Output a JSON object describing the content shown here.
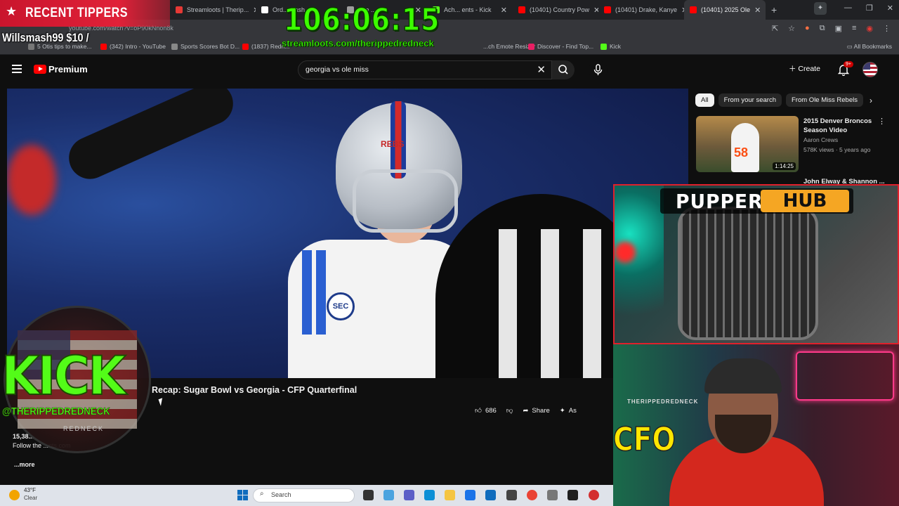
{
  "browser": {
    "tabs": [
      {
        "label": "Streamloots | Therip...",
        "color": "#e53935"
      },
      {
        "label": "Ord... Dash...",
        "color": "#ffffff"
      },
      {
        "label": "The ...",
        "color": "#9e9e9e"
      },
      {
        "label": "Ach... ents - Kick",
        "color": "#53fc18"
      },
      {
        "label": "(10401) Country Pow",
        "color": "#ff0000"
      },
      {
        "label": "(10401) Drake, Kanye",
        "color": "#ff0000"
      },
      {
        "label": "(10401) 2025 Ole",
        "color": "#ff0000",
        "active": true
      }
    ],
    "url": "youtube.com/watch?v=oP90kNnon8k",
    "bookmarks": [
      "(342) Intro - YouTube",
      "Sports Scores Bot D...",
      "(1837) Redn...",
      "...ch Emote Resizer",
      "Discover - Find Top...",
      "Kick"
    ],
    "bookmark_prefix": "5 Otis tips to make...",
    "all_bookmarks": "All Bookmarks"
  },
  "youtube": {
    "brand": "Premium",
    "search_value": "georgia vs ole miss",
    "create_label": "Create",
    "notification_count": "9+",
    "video_title": "Recap: Sugar Bowl vs Georgia - CFP Quarterfinal",
    "views": "15,38...",
    "description": "Follow the ...nts.com",
    "more_label": "...more",
    "likes": "686",
    "share_label": "Share",
    "ask_label": "As",
    "jersey_text": "REBS",
    "patch_text": "SEC",
    "chips": [
      "All",
      "From your search",
      "From Ole Miss Rebels"
    ],
    "recommendations": [
      {
        "title": "2015 Denver Broncos Season Video",
        "channel": "Aaron Crews",
        "views": "578K views · 5 years ago",
        "duration": "1:14:25",
        "jersey_number": "58"
      },
      {
        "title": "John Elway & Shannon ..."
      }
    ]
  },
  "overlay": {
    "recent_tippers_label": "RECENT TIPPERS",
    "tipper": "Willsmash99 $10 /",
    "timer": "106:06:15",
    "timer_url": "streamloots.com/therippedredneck",
    "kick_word": "KICK",
    "kick_handle": "@THERIPPEDREDNECK",
    "kick_sub": "REDNECK",
    "pupper_word1": "PUPPER",
    "pupper_word2": "HUB",
    "webcam_sign": "THERIPPEDREDNECK",
    "cfp_text": "CFO"
  },
  "taskbar": {
    "temperature": "43°F",
    "condition": "Clear",
    "search_placeholder": "Search"
  }
}
